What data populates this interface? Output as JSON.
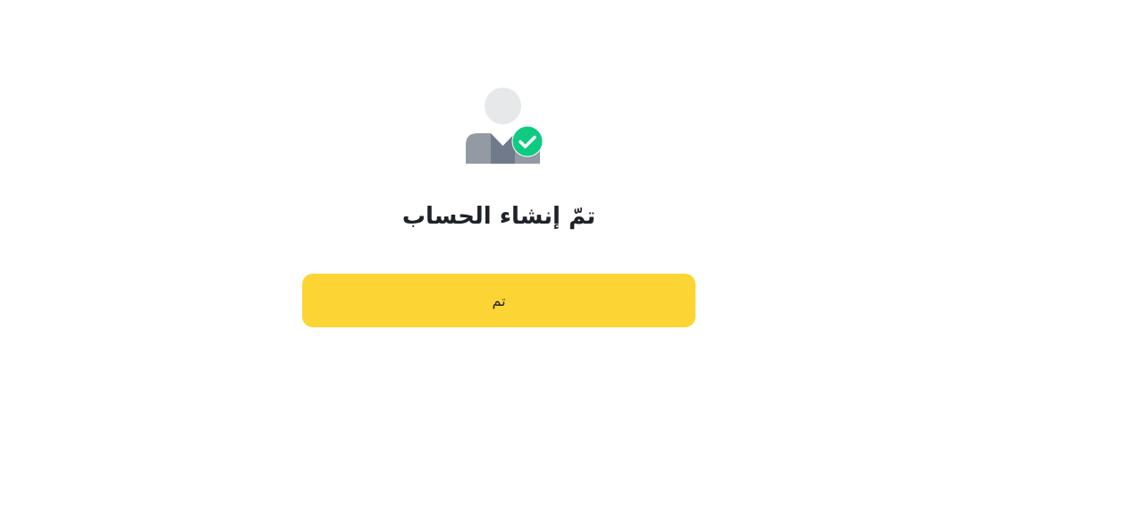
{
  "illustration": {
    "icon": "user-check-icon",
    "colors": {
      "head": "#e6e8ea",
      "body_light": "#939aa3",
      "body_dark": "#707a8a",
      "check_bg": "#0ecb81",
      "check_mark": "#ffffff"
    }
  },
  "title": "تمّ إنشاء الحساب",
  "done_button": {
    "label": "تم",
    "color": "#fcd535"
  }
}
